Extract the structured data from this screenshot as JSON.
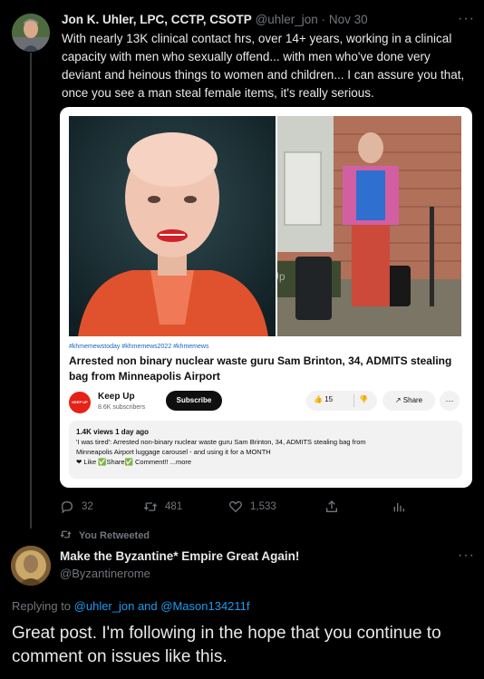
{
  "main_tweet": {
    "author_name": "Jon K. Uhler, LPC, CCTP, CSOTP",
    "handle": "@uhler_jon",
    "separator": "·",
    "date": "Nov 30",
    "more_label": "···",
    "text": "With nearly 13K clinical contact hrs, over 14+ years, working in a clinical capacity with men who sexually offend... with men who've done very deviant and heinous things to women and children... I can assure you that, once you see a man steal female items, it's really serious."
  },
  "card": {
    "watermark": "©Keep Up",
    "hashtags": "#khmemewstoday #khmemews2022 #khmemews",
    "title": "Arrested non binary nuclear waste guru Sam Brinton, 34, ADMITS stealing bag from Minneapolis Airport",
    "channel_logo_text": "KEEP UP",
    "channel_name": "Keep Up",
    "channel_subs": "8.6K subscribers",
    "subscribe_label": "Subscribe",
    "like_icon": "👍",
    "like_count": "15",
    "dislike_icon": "👎",
    "share_label": "↗ Share",
    "more_label": "···",
    "views": "1.4K views  1 day ago",
    "desc_line1": "'I was tired': Arrested non-binary nuclear waste guru Sam Brinton, 34, ADMITS stealing bag from",
    "desc_line2": "Minneapolis Airport luggage carousel - and using it for a MONTH",
    "desc_line3": "❤ Like ✅Share✅ Comment!! ...more"
  },
  "actions": {
    "reply_count": "32",
    "retweet_count": "481",
    "like_count": "1,533"
  },
  "reply": {
    "retweeted_label": "You Retweeted",
    "author_name": "Make the Byzantine* Empire Great Again!",
    "handle": "@Byzantinerome",
    "more_label": "···",
    "replying_prefix": "Replying to ",
    "replying_user1": "@uhler_jon",
    "replying_and": " and ",
    "replying_user2": "@Mason134211f",
    "text": "Great post. I'm following in the hope that you continue to comment on issues like this."
  },
  "colors": {
    "background": "#000000",
    "text": "#e7e9ea",
    "muted": "#71767b",
    "link": "#1d9bf0",
    "youtube_red": "#e62117"
  }
}
